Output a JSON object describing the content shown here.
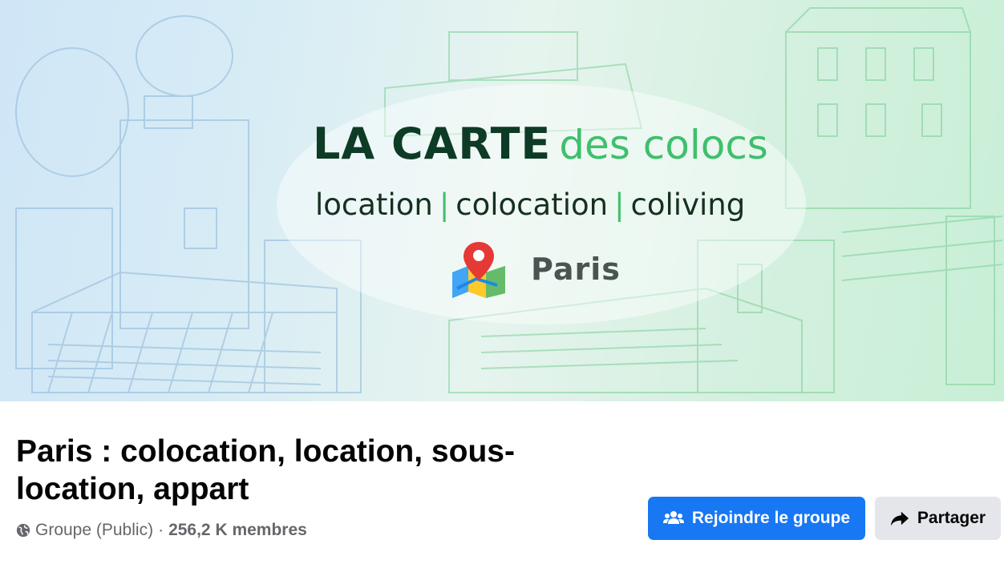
{
  "cover": {
    "brand_main": "LA CARTE",
    "brand_sub": "des colocs",
    "tagline": [
      "location",
      "colocation",
      "coliving"
    ],
    "tagline_separator": "|",
    "city": "Paris",
    "city_icon": "map-pin-icon"
  },
  "group": {
    "name": "Paris : colocation, location, sous-location, appart",
    "type_label": "Groupe (Public)",
    "separator": "·",
    "members": "256,2 K membres",
    "privacy_icon": "globe-icon"
  },
  "actions": {
    "join_label": "Rejoindre le groupe",
    "join_icon": "people-plus-icon",
    "share_label": "Partager",
    "share_icon": "share-arrow-icon"
  },
  "colors": {
    "primary": "#1877f2",
    "secondary_button": "#e4e6eb",
    "brand_dark": "#0e3b26",
    "brand_green": "#3fbf6d"
  }
}
